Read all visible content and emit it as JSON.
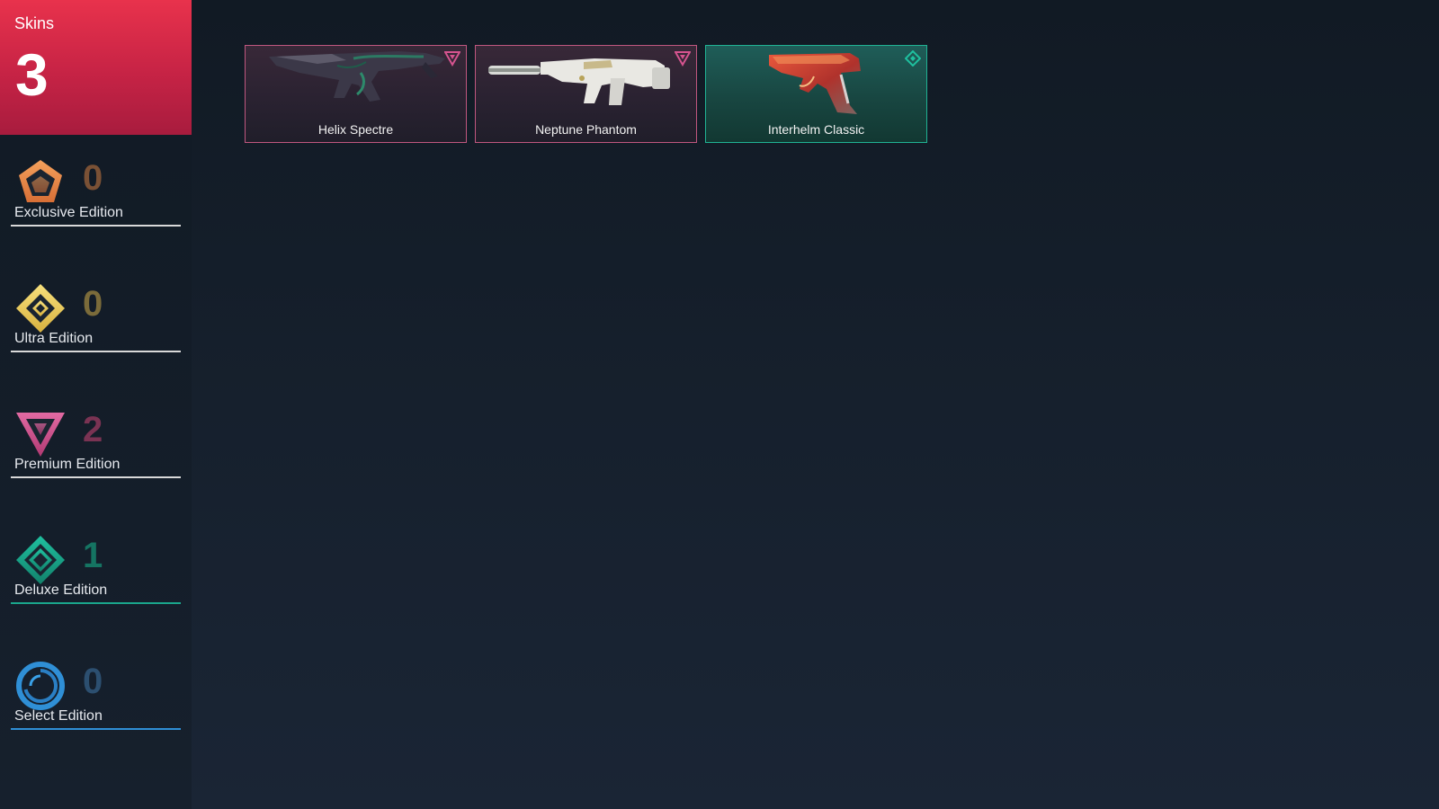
{
  "summary": {
    "label": "Skins",
    "count": "3"
  },
  "tiers": [
    {
      "label": "Exclusive Edition",
      "count": "0",
      "icon": "exclusive-edition-icon",
      "color": "#e8904e",
      "count_color": "#7a5135",
      "line_color": "#d9d9d9"
    },
    {
      "label": "Ultra Edition",
      "count": "0",
      "icon": "ultra-edition-icon",
      "color": "#f0cf5d",
      "count_color": "#7b6b3a",
      "line_color": "#d9d9d9"
    },
    {
      "label": "Premium Edition",
      "count": "2",
      "icon": "premium-edition-icon",
      "color": "#d5548f",
      "count_color": "#7a3353",
      "line_color": "#d9d9d9"
    },
    {
      "label": "Deluxe Edition",
      "count": "1",
      "icon": "deluxe-edition-icon",
      "color": "#1aa68c",
      "count_color": "#157462",
      "line_color": "#1aa68c"
    },
    {
      "label": "Select Edition",
      "count": "0",
      "icon": "select-edition-icon",
      "color": "#2f8fd6",
      "count_color": "#2c4f70",
      "line_color": "#2f8fd6"
    }
  ],
  "skins": [
    {
      "name": "Helix Spectre",
      "tier": "premium",
      "icon": "premium-edition-icon",
      "weapon_icon": "spectre-gun-icon"
    },
    {
      "name": "Neptune Phantom",
      "tier": "premium",
      "icon": "premium-edition-icon",
      "weapon_icon": "phantom-rifle-icon"
    },
    {
      "name": "Interhelm Classic",
      "tier": "deluxe",
      "icon": "deluxe-edition-icon",
      "weapon_icon": "classic-pistol-icon"
    }
  ]
}
